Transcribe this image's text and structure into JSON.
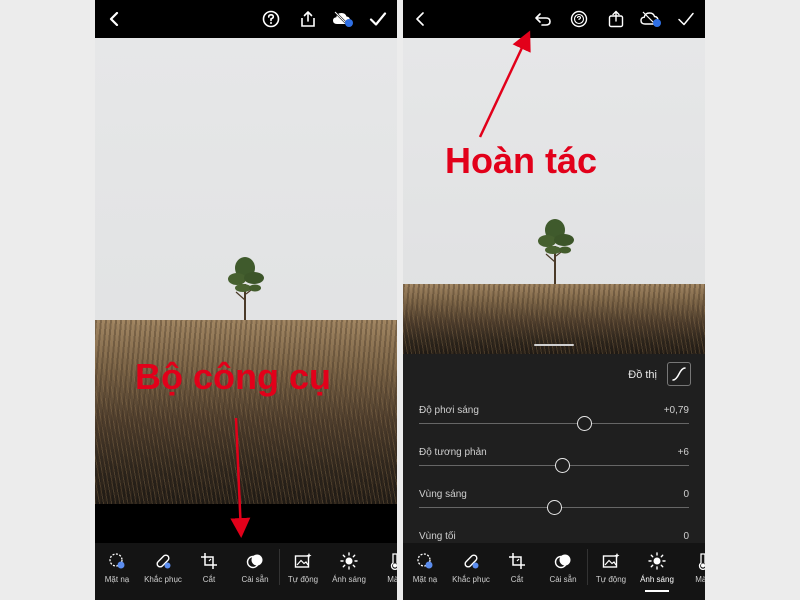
{
  "left_screen": {
    "annotation": "Bộ công cụ",
    "tools": [
      {
        "label": "Mặt nạ",
        "icon": "mask-icon"
      },
      {
        "label": "Khắc phục",
        "icon": "healing-bandage-icon"
      },
      {
        "label": "Cắt",
        "icon": "crop-icon"
      },
      {
        "label": "Cài sẵn",
        "icon": "presets-icon"
      },
      {
        "label": "Tự động",
        "icon": "auto-image-icon"
      },
      {
        "label": "Ánh sáng",
        "icon": "sun-icon"
      },
      {
        "label": "Màu",
        "icon": "thermometer-icon"
      }
    ]
  },
  "right_screen": {
    "annotation": "Hoàn tác",
    "curve_label": "Đồ thị",
    "sliders": [
      {
        "name": "Độ phơi sáng",
        "value": "+0,79",
        "position": 0.61
      },
      {
        "name": "Độ tương phản",
        "value": "+6",
        "position": 0.53
      },
      {
        "name": "Vùng sáng",
        "value": "0",
        "position": 0.5
      },
      {
        "name": "Vùng tối",
        "value": "0",
        "position": 0.5
      }
    ],
    "tools": [
      {
        "label": "Mặt nạ",
        "icon": "mask-icon"
      },
      {
        "label": "Khắc phục",
        "icon": "healing-bandage-icon"
      },
      {
        "label": "Cắt",
        "icon": "crop-icon"
      },
      {
        "label": "Cài sẵn",
        "icon": "presets-icon"
      },
      {
        "label": "Tự động",
        "icon": "auto-image-icon"
      },
      {
        "label": "Ánh sáng",
        "icon": "sun-icon"
      },
      {
        "label": "Màu",
        "icon": "thermometer-icon"
      }
    ],
    "active_tool": "Ánh sáng"
  },
  "colors": {
    "annotation_red": "#e2001a",
    "cloud_sync_dot": "#2f6fe4",
    "mask_icon_accent": "#5b8def"
  }
}
